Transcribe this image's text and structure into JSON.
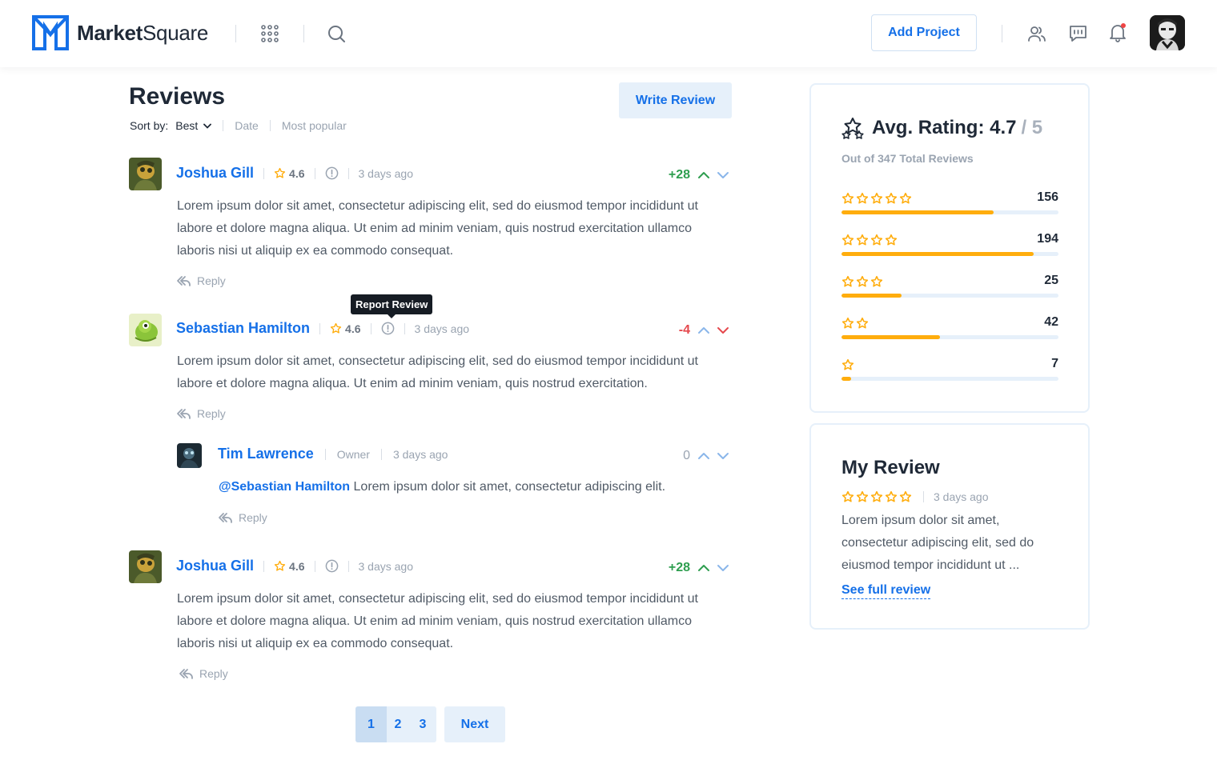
{
  "header": {
    "brand_bold": "Market",
    "brand_light": "Square",
    "add_project_label": "Add Project",
    "icons": [
      "apps-grid-icon",
      "search-icon",
      "users-icon",
      "chat-icon",
      "bell-icon"
    ],
    "brand_color": "#1570e8",
    "notification_dot_color": "#ef4444"
  },
  "reviews_section": {
    "title": "Reviews",
    "sort_label": "Sort by:",
    "sort_selected": "Best",
    "sort_options": [
      "Date",
      "Most popular"
    ],
    "write_review_label": "Write Review",
    "tooltip": "Report Review",
    "items": [
      {
        "name": "Joshua Gill",
        "rating": "4.6",
        "time": "3 days ago",
        "body": "Lorem ipsum dolor sit amet, consectetur adipiscing elit, sed do eiusmod tempor incididunt ut labore et dolore magna aliqua. Ut enim ad minim veniam, quis nostrud exercitation ullamco laboris nisi ut aliquip ex ea commodo consequat.",
        "reply_label": "Reply",
        "votes": "+28",
        "vote_state": "up"
      },
      {
        "name": "Sebastian Hamilton",
        "rating": "4.6",
        "time": "3 days ago",
        "body": "Lorem ipsum dolor sit amet, consectetur adipiscing elit, sed do eiusmod tempor incididunt ut labore et dolore magna aliqua. Ut enim ad minim veniam, quis nostrud exercitation.",
        "reply_label": "Reply",
        "votes": "-4",
        "vote_state": "down",
        "replies": [
          {
            "name": "Tim Lawrence",
            "role": "Owner",
            "time": "3 days ago",
            "mention": "@Sebastian Hamilton",
            "body": " Lorem ipsum dolor sit amet, consectetur adipiscing elit.",
            "reply_label": "Reply",
            "votes": "0",
            "vote_state": "none"
          }
        ]
      },
      {
        "name": "Joshua Gill",
        "rating": "4.6",
        "time": "3 days ago",
        "body": "Lorem ipsum dolor sit amet, consectetur adipiscing elit, sed do eiusmod tempor incididunt ut labore et dolore magna aliqua. Ut enim ad minim veniam, quis nostrud exercitation ullamco laboris nisi ut aliquip ex ea commodo consequat.",
        "reply_label": "Reply",
        "votes": "+28",
        "vote_state": "up"
      }
    ],
    "pagination": {
      "pages": [
        "1",
        "2",
        "3"
      ],
      "current": "1",
      "next_label": "Next"
    },
    "colors": {
      "positive": "#2e9e4f",
      "negative": "#e5484d",
      "neutral": "#9aa4b1",
      "star": "#ffad0d"
    }
  },
  "rating_summary": {
    "title": "Avg. Rating: 4.7",
    "total": "/ 5",
    "subtitle": "Out of 347 Total Reviews",
    "distribution": [
      {
        "stars": 5,
        "count": "156",
        "fraction": 0.7
      },
      {
        "stars": 4,
        "count": "194",
        "fraction": 0.885
      },
      {
        "stars": 3,
        "count": "25",
        "fraction": 0.275
      },
      {
        "stars": 2,
        "count": "42",
        "fraction": 0.455
      },
      {
        "stars": 1,
        "count": "7",
        "fraction": 0.045
      }
    ]
  },
  "my_review": {
    "title": "My Review",
    "stars": 5,
    "time": "3 days ago",
    "body": "Lorem ipsum dolor sit amet, consectetur adipiscing elit, sed do eiusmod tempor incididunt ut ...",
    "link_label": "See full review"
  }
}
